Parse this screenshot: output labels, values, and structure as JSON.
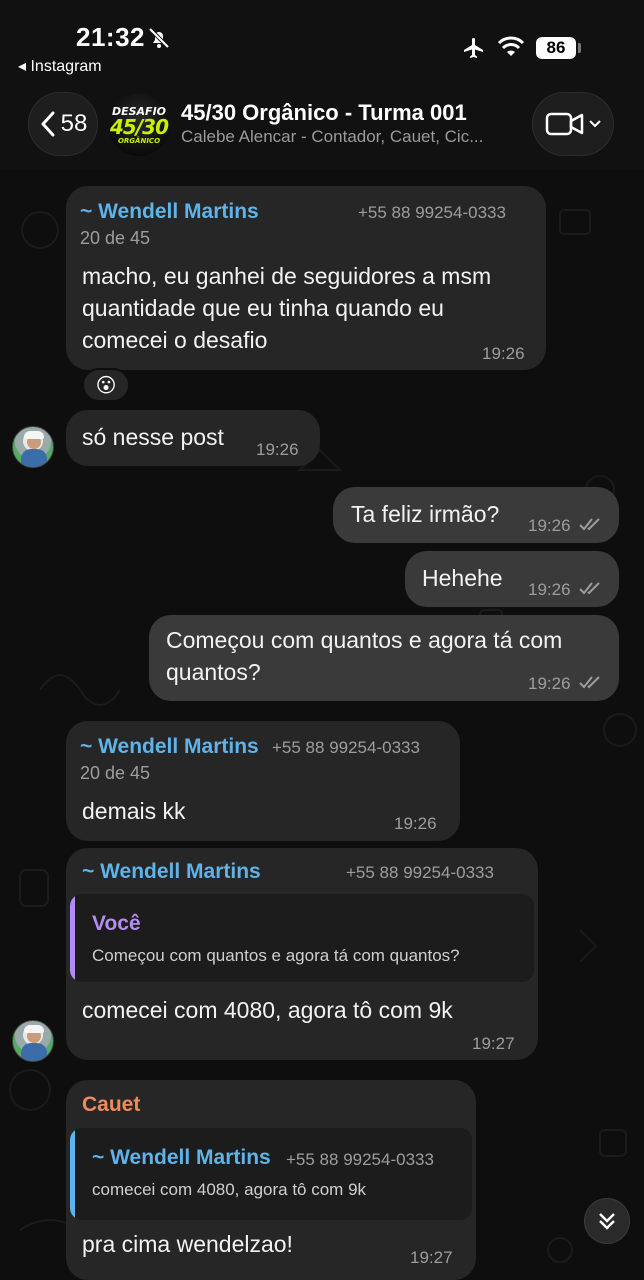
{
  "status_bar": {
    "time": "21:32",
    "back_app": "◂ Instagram",
    "battery": "86"
  },
  "header": {
    "back_count": "58",
    "avatar_text": [
      "DESAFIO",
      "45/30",
      "ORGÂNICO"
    ],
    "title": "45/30 Orgânico - Turma 001",
    "subtitle": "Calebe Alencar - Contador, Cauet, Cic..."
  },
  "messages": [
    {
      "sender": "~ Wendell Martins",
      "phone": "+55 88 99254-0333",
      "rank": "20 de 45",
      "lines": [
        "macho, eu ganhei de seguidores a msm",
        "quantidade que eu tinha quando eu",
        "comecei o desafio"
      ],
      "time": "19:26",
      "reaction": "😮"
    },
    {
      "text": "só nesse post",
      "time": "19:26"
    },
    {
      "text": "Ta feliz irmão?",
      "time": "19:26"
    },
    {
      "text": "Hehehe",
      "time": "19:26"
    },
    {
      "lines": [
        "Começou com quantos e agora tá com",
        "quantos?"
      ],
      "time": "19:26"
    },
    {
      "sender": "~ Wendell Martins",
      "phone": "+55 88 99254-0333",
      "rank": "20 de 45",
      "text": "demais kk",
      "time": "19:26"
    },
    {
      "sender": "~ Wendell Martins",
      "phone": "+55 88 99254-0333",
      "reply_name": "Você",
      "reply_text": "Começou com quantos e agora tá com quantos?",
      "text": "comecei com 4080, agora tô com 9k",
      "time": "19:27"
    },
    {
      "sender": "Cauet",
      "reply_name": "~ Wendell Martins",
      "reply_phone": "+55 88 99254-0333",
      "reply_text": "comecei com 4080, agora tô com 9k",
      "text": "pra cima wendelzao!",
      "time": "19:27"
    }
  ],
  "colors": {
    "sender_blue": "#5fb3e8",
    "you_purple": "#b48cf0",
    "cauet_orange": "#f08a5d",
    "incoming_bubble": "#262626",
    "outgoing_bubble": "#3a3a3a"
  }
}
